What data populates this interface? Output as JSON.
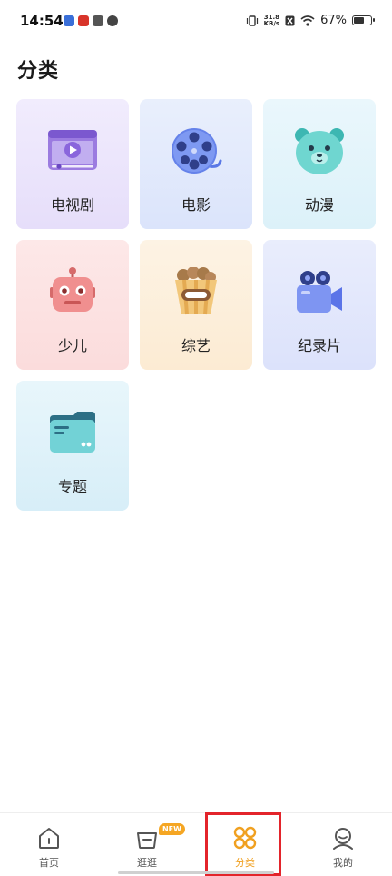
{
  "status_bar": {
    "time": "14:54",
    "net_speed_value": "31.8",
    "net_speed_unit": "KB/s",
    "battery_text": "67%",
    "battery_level": 0.67
  },
  "page": {
    "title": "分类"
  },
  "categories": [
    {
      "label": "电视剧",
      "icon": "tv-series-icon",
      "color": "#9b7be0"
    },
    {
      "label": "电影",
      "icon": "film-reel-icon",
      "color": "#6f8df0"
    },
    {
      "label": "动漫",
      "icon": "bear-face-icon",
      "color": "#5ccdc8"
    },
    {
      "label": "少儿",
      "icon": "robot-icon",
      "color": "#ee8080"
    },
    {
      "label": "综艺",
      "icon": "popcorn-icon",
      "color": "#e8b460"
    },
    {
      "label": "纪录片",
      "icon": "video-camera-icon",
      "color": "#6b85f0"
    },
    {
      "label": "专题",
      "icon": "folder-card-icon",
      "color": "#5fc2c8"
    }
  ],
  "bottom_nav": {
    "items": [
      {
        "label": "首页",
        "icon": "home-icon"
      },
      {
        "label": "逛逛",
        "icon": "basket-icon",
        "badge": "NEW"
      },
      {
        "label": "分类",
        "icon": "grid-circles-icon",
        "active": true
      },
      {
        "label": "我的",
        "icon": "user-icon"
      }
    ]
  },
  "colors": {
    "accent": "#f0a020",
    "highlight": "#e3242b"
  }
}
